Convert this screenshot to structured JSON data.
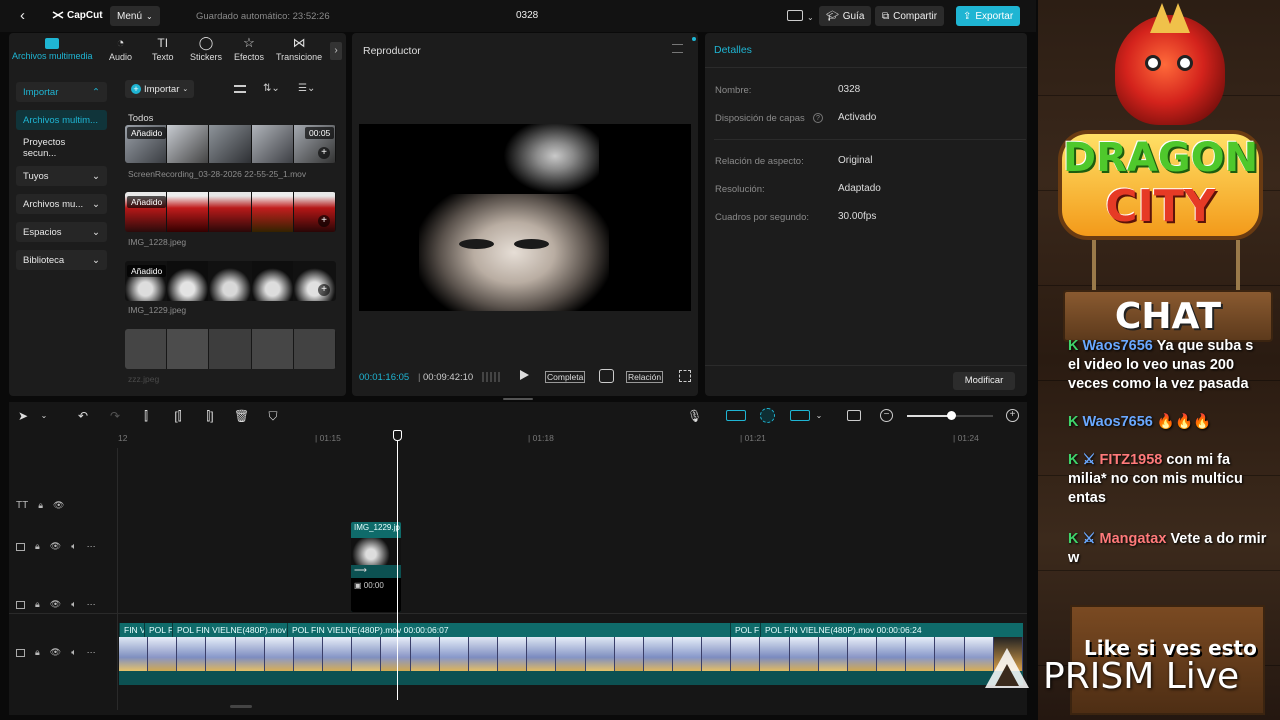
{
  "app": {
    "logo": "CapCut",
    "menu_label": "Menú",
    "autosave": "Guardado automático: 23:52:26",
    "project_title": "0328",
    "guide_label": "Guía",
    "share_label": "Compartir",
    "export_label": "Exportar"
  },
  "media_tabs": [
    {
      "label": "Archivos multimedia",
      "icon": "media-icon"
    },
    {
      "label": "Audio",
      "icon": "audio-icon"
    },
    {
      "label": "Texto",
      "icon": "text-icon"
    },
    {
      "label": "Stickers",
      "icon": "sticker-icon"
    },
    {
      "label": "Efectos",
      "icon": "effects-icon"
    },
    {
      "label": "Transicione",
      "icon": "transitions-icon"
    }
  ],
  "sidebar": {
    "items": [
      {
        "label": "Importar"
      },
      {
        "label": "Archivos multim..."
      },
      {
        "label": "Proyectos secun..."
      },
      {
        "label": "Tuyos"
      },
      {
        "label": "Archivos mu..."
      },
      {
        "label": "Espacios"
      },
      {
        "label": "Biblioteca"
      }
    ]
  },
  "media": {
    "import_label": "Importar",
    "all_label": "Todos",
    "items": [
      {
        "badge": "Añadido",
        "duration": "00:05",
        "name": "ScreenRecording_03-28-2026 22-55-25_1.mov"
      },
      {
        "badge": "Añadido",
        "name": "IMG_1228.jpeg"
      },
      {
        "badge": "Añadido",
        "name": "IMG_1229.jpeg"
      },
      {
        "name": "zzz.jpeg"
      }
    ]
  },
  "player": {
    "title": "Reproductor",
    "current_time": "00:01:16:05",
    "total_time": "00:09:42:10",
    "full_label": "Completa",
    "ratio_label": "Relación"
  },
  "details": {
    "title": "Detalles",
    "rows": [
      {
        "label": "Nombre:",
        "value": "0328"
      },
      {
        "label": "Disposición de capas",
        "value": "Activado"
      },
      {
        "label": "Relación de aspecto:",
        "value": "Original"
      },
      {
        "label": "Resolución:",
        "value": "Adaptado"
      },
      {
        "label": "Cuadros por segundo:",
        "value": "30.00fps"
      }
    ],
    "modify_label": "Modificar"
  },
  "timeline": {
    "ticks": [
      "12",
      "01:15",
      "01:18",
      "01:21",
      "01:24"
    ],
    "overlay_clip_name": "IMG_1229.jp",
    "overlay_clip_time": "00:00",
    "main_clips": [
      {
        "label": "FIN V"
      },
      {
        "label": "POL F"
      },
      {
        "label": "POL FIN VIELNE(480P).mov"
      },
      {
        "label": "POL FIN VIELNE(480P).mov   00:00:06:07"
      },
      {
        "label": "POL F"
      },
      {
        "label": "POL FIN VIELNE(480P).mov   00:00:06:24"
      }
    ]
  },
  "overlay": {
    "brand_line1": "DRAGON",
    "brand_line2": "CITY",
    "chat_title": "CHAT",
    "chat": [
      {
        "user": "Waos7656",
        "text": "Ya que suba s el video lo veo unas 200 veces como la vez pasada"
      },
      {
        "user": "Waos7656",
        "text": "🔥🔥🔥"
      },
      {
        "user": "FITZ1958",
        "text": "con mi fa milia* no con mis multicu entas"
      },
      {
        "user": "Mangatax",
        "text": "Vete a do rmir w"
      }
    ],
    "like_text": "Like si ves esto",
    "prism_text": "PRISM Live"
  },
  "colors": {
    "accent": "#1fb5d3",
    "teal_clip": "#0f6b6a",
    "panel": "#1c1c1c"
  }
}
